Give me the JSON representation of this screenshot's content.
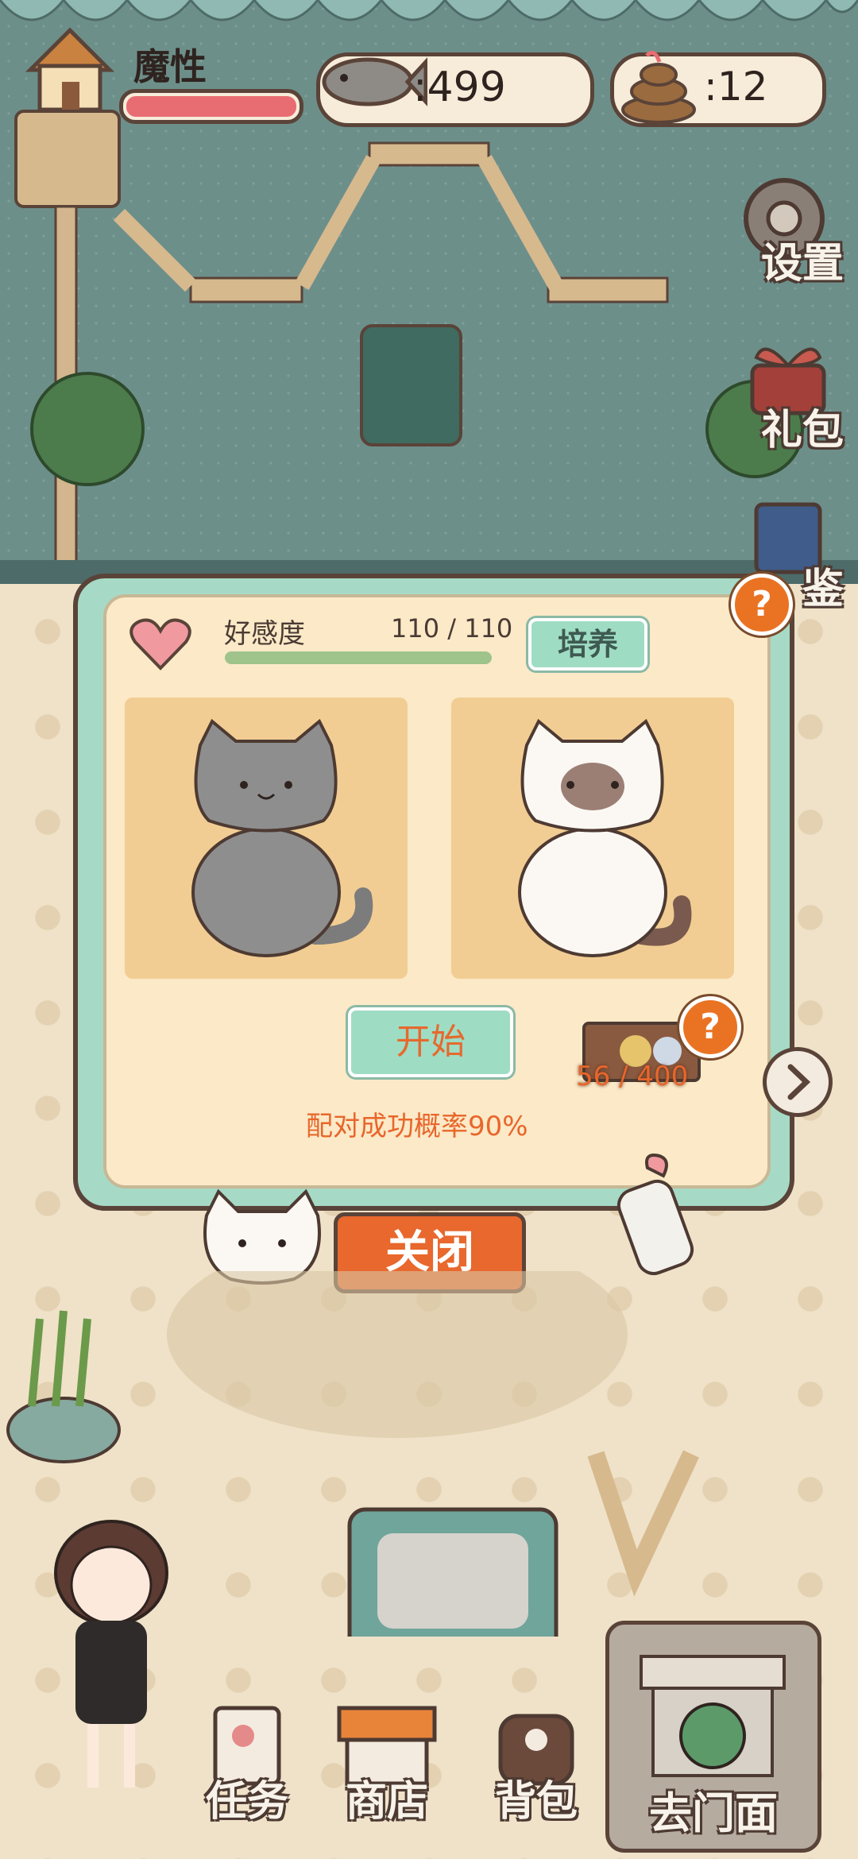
{
  "hud": {
    "player_name": "魔性",
    "fish_count": ":499",
    "poop_count": ":12",
    "health_level": 1.0
  },
  "side_menu": {
    "settings_label": "设置",
    "gift_label": "礼包",
    "album_label": "鉴"
  },
  "panel": {
    "affection_label": "好感度",
    "affection_value": "110 / 110",
    "affection_level": 1.0,
    "train_label": "培养",
    "start_label": "开始",
    "success_rate_text": "配对成功概率90%",
    "box_count": "56 / 400",
    "help_label": "?",
    "close_label": "关闭"
  },
  "bottom_nav": {
    "tasks_label": "任务",
    "shop_label": "商店",
    "bag_label": "背包",
    "storefront_label": "去门面"
  },
  "colors": {
    "accent_orange": "#e8682d",
    "mint": "#a6dac6",
    "panel_bg": "#fbe9c7",
    "card_bg": "#f2cd93",
    "outline": "#5a4338"
  }
}
